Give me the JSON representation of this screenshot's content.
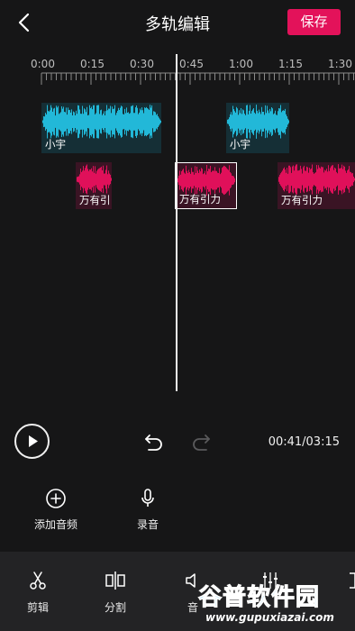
{
  "header": {
    "title": "多轨编辑",
    "save_label": "保存"
  },
  "timeline": {
    "ticks": [
      "0:00",
      "0:15",
      "0:30",
      "0:45",
      "1:00",
      "1:15",
      "1:30"
    ]
  },
  "tracks": {
    "clip1_label": "小宇",
    "clip2_label": "小宇",
    "clip3_label": "万有引",
    "clip4_label": "万有引力",
    "clip5_label": "万有引力"
  },
  "playback": {
    "time": "00:41/03:15"
  },
  "tools": {
    "add_audio": "添加音频",
    "record": "录音"
  },
  "bottom_tabs": {
    "cut": "剪辑",
    "split": "分割",
    "partial": "音"
  },
  "watermark": {
    "brand": "谷普软件园",
    "url": "www.gupuxiazai.com"
  },
  "colors": {
    "accent": "#e3125a",
    "track_blue": "#22b8d8",
    "track_pink": "#e0105a"
  }
}
